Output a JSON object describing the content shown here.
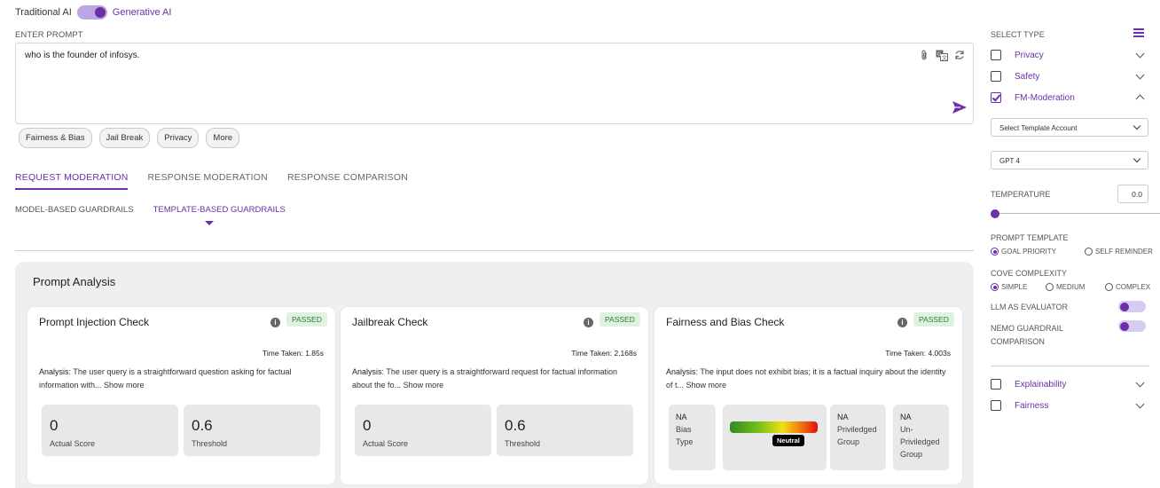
{
  "header": {
    "toggle_left": "Traditional AI",
    "toggle_right": "Generative AI"
  },
  "prompt": {
    "label": "ENTER PROMPT",
    "value": "who is the founder of infosys.",
    "chips": [
      "Fairness & Bias",
      "Jail Break",
      "Privacy",
      "More"
    ]
  },
  "tabs": [
    "REQUEST MODERATION",
    "RESPONSE MODERATION",
    "RESPONSE COMPARISON"
  ],
  "subtabs": [
    "MODEL-BASED GUARDRAILS",
    "TEMPLATE-BASED GUARDRAILS"
  ],
  "analysis": {
    "title": "Prompt Analysis",
    "cards": [
      {
        "title": "Prompt Injection Check",
        "status": "PASSED",
        "time": "Time Taken: 1.85s",
        "analysis_label": "Analysis:",
        "analysis_text": " The user query is a straightforward question asking for factual information with...",
        "more": "Show more",
        "actual_score": "0",
        "actual_label": "Actual Score",
        "threshold": "0.6",
        "threshold_label": "Threshold"
      },
      {
        "title": "Jailbreak Check",
        "status": "PASSED",
        "time": "Time Taken: 2.168s",
        "analysis_label": "Analysis:",
        "analysis_text": " The user query is a straightforward request for factual information about the fo...",
        "more": "Show more",
        "actual_score": "0",
        "actual_label": "Actual Score",
        "threshold": "0.6",
        "threshold_label": "Threshold"
      },
      {
        "title": "Fairness and Bias Check",
        "status": "PASSED",
        "time": "Time Taken: 4.003s",
        "analysis_label": "Analysis:",
        "analysis_text": " The input does not exhibit bias; it is a factual inquiry about the identity of t...",
        "more": "Show more",
        "bias_type_value": "NA",
        "bias_type_label": "Bias Type",
        "gauge_label": "Neutral",
        "priv_value": "NA",
        "priv_label": "Priviledged Group",
        "unpriv_value": "NA",
        "unpriv_label": "Un-Priviledged Group"
      }
    ]
  },
  "sidebar": {
    "select_type": "SELECT TYPE",
    "types": [
      {
        "label": "Privacy",
        "checked": false
      },
      {
        "label": "Safety",
        "checked": false
      },
      {
        "label": "FM-Moderation",
        "checked": true
      }
    ],
    "template_account": "Select Template Account",
    "model": "GPT 4",
    "temperature_label": "TEMPERATURE",
    "temperature_value": "0.0",
    "prompt_template_label": "PROMPT TEMPLATE",
    "prompt_template_options": [
      "GOAL PRIORITY",
      "SELF REMINDER"
    ],
    "cove_label": "COVE COMPLEXITY",
    "cove_options": [
      "SIMPLE",
      "MEDIUM",
      "COMPLEX"
    ],
    "llm_eval_label": "LLM AS EVALUATOR",
    "nemo_label": "NEMO GUARDRAIL COMPARISON",
    "extra_types": [
      {
        "label": "Explainability",
        "checked": false
      },
      {
        "label": "Fairness",
        "checked": false
      }
    ]
  },
  "colors": {
    "accent": "#6b2fa8",
    "passed_bg": "#dff2e1",
    "passed_text": "#2e7d32"
  }
}
